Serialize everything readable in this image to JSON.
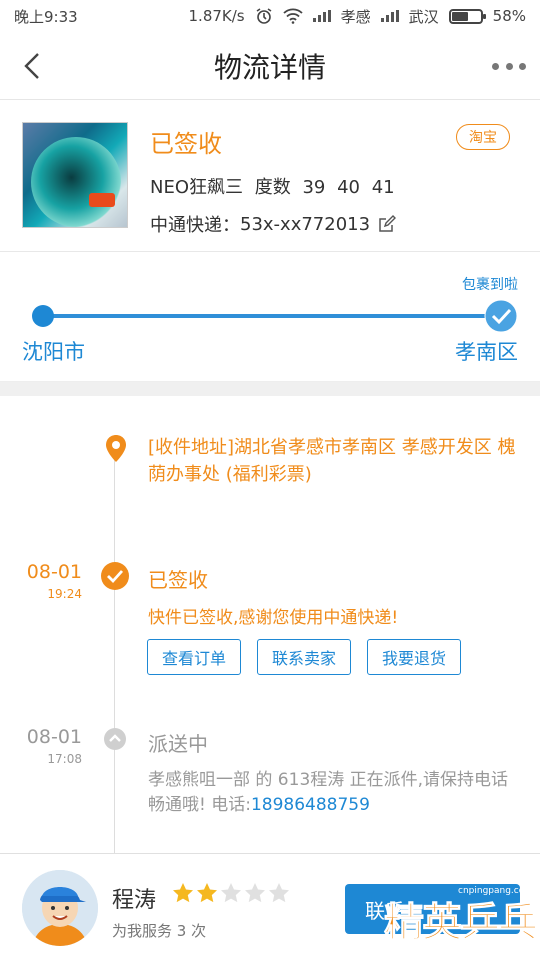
{
  "status_bar": {
    "time": "晚上9:33",
    "speed": "1.87K/s",
    "carrier1": "孝感",
    "carrier2": "武汉",
    "battery": "58%",
    "battery_level": 0.58,
    "icons": [
      "alarm-icon",
      "wifi-icon",
      "signal-icon",
      "signal-icon",
      "battery-icon"
    ]
  },
  "header": {
    "title": "物流详情",
    "back_icon": "chevron-left-icon",
    "more_icon": "more-icon"
  },
  "product": {
    "status": "已签收",
    "name": "NEO狂飙三  度数  39  40  41",
    "tracking_label": "中通快递：",
    "tracking_number": "53x-xx772013",
    "source_badge": "淘宝"
  },
  "route": {
    "arrived_label": "包裹到啦",
    "from": "沈阳市",
    "to": "孝南区",
    "progress": 1.0
  },
  "timeline": {
    "address": "[收件地址]湖北省孝感市孝南区 孝感开发区 槐荫办事处 (福利彩票)",
    "events": [
      {
        "date": "08-01",
        "time": "19:24",
        "title": "已签收",
        "desc": "快件已签收,感谢您使用中通快递!",
        "active": true,
        "buttons": [
          "查看订单",
          "联系卖家",
          "我要退货"
        ]
      },
      {
        "date": "08-01",
        "time": "17:08",
        "title": "派送中",
        "desc": "孝感熊咀一部 的 613程涛 正在派件,请保持电话畅通哦! 电话:",
        "phone": "18986488759",
        "active": false
      }
    ]
  },
  "courier": {
    "name": "程涛",
    "rating": 2,
    "rating_max": 5,
    "served_text": "为我服务 3 次",
    "call_label": "联系"
  },
  "watermark": {
    "main": "精英乒乓网",
    "sub": "cnpingpang.com"
  },
  "colors": {
    "accent_orange": "#f08c1b",
    "accent_blue": "#1e88d4",
    "muted": "#999999"
  }
}
